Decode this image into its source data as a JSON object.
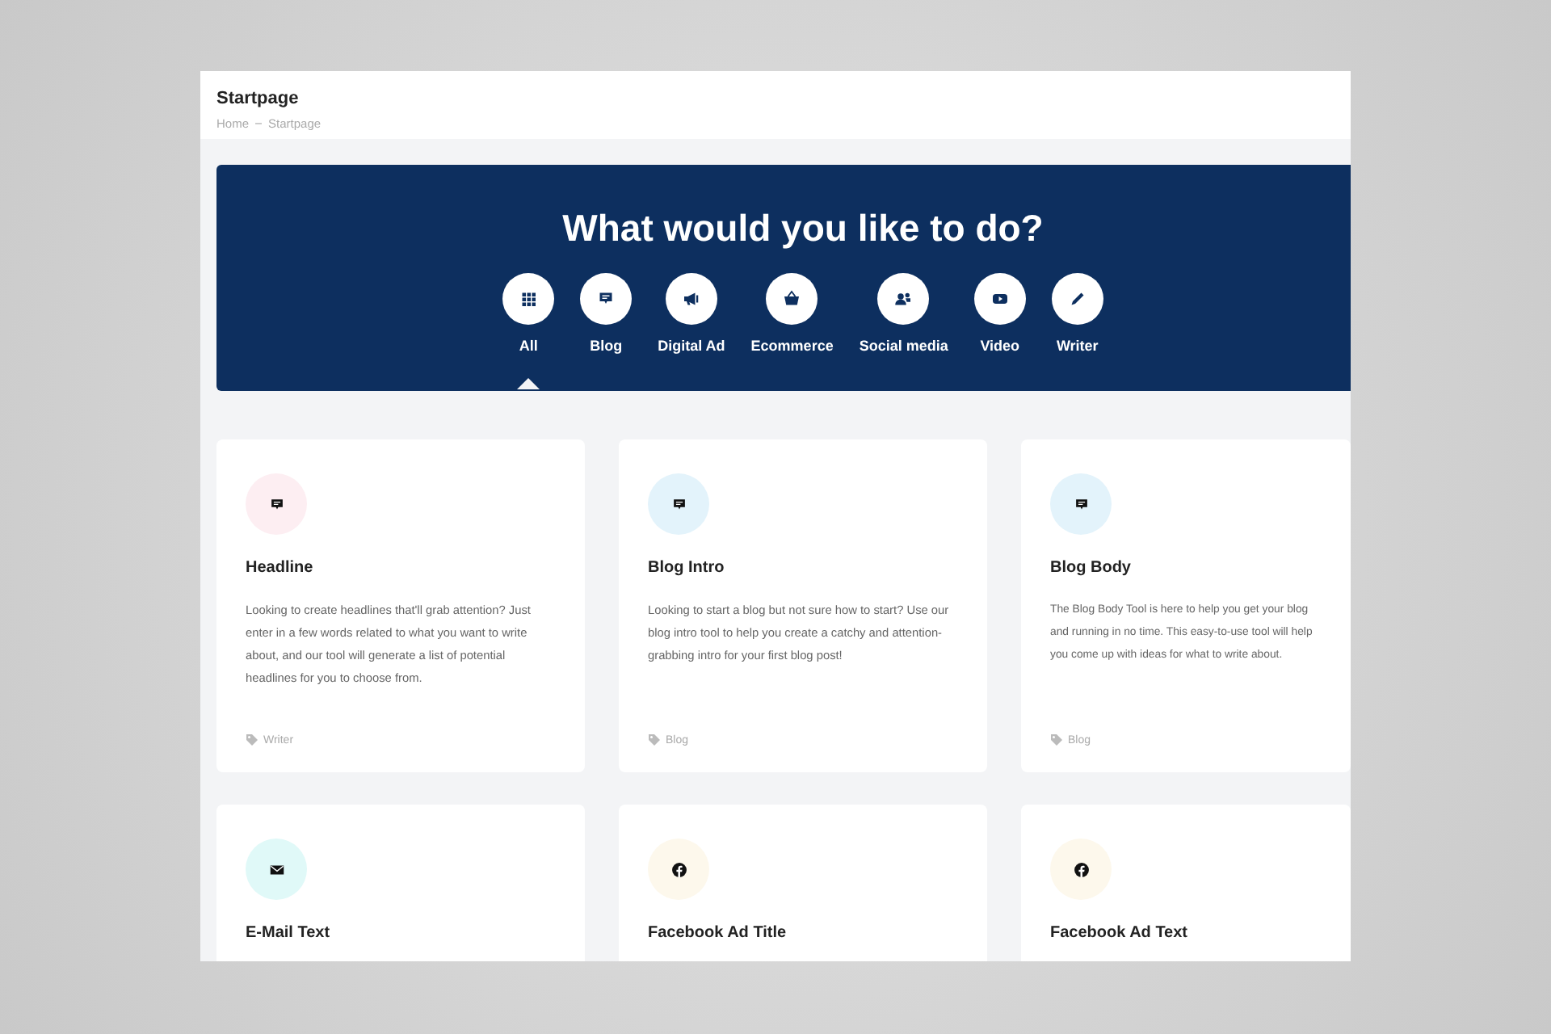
{
  "header": {
    "title": "Startpage",
    "breadcrumb": [
      "Home",
      "Startpage"
    ]
  },
  "banner": {
    "title": "What would you like to do?",
    "categories": [
      {
        "label": "All",
        "kind": "grid",
        "selected": true
      },
      {
        "label": "Blog",
        "kind": "chat",
        "selected": false
      },
      {
        "label": "Digital Ad",
        "kind": "megaphone",
        "selected": false
      },
      {
        "label": "Ecommerce",
        "kind": "basket",
        "selected": false
      },
      {
        "label": "Social media",
        "kind": "people",
        "selected": false
      },
      {
        "label": "Video",
        "kind": "video",
        "selected": false
      },
      {
        "label": "Writer",
        "kind": "pencil",
        "selected": false
      }
    ]
  },
  "cards": [
    {
      "title": "Headline",
      "kind": "chat",
      "color": "#fdeef2",
      "description": "Looking to create headlines that'll grab attention? Just enter in a few words related to what you want to write about, and our tool will generate a list of potential headlines for you to choose from.",
      "tag": "Writer"
    },
    {
      "title": "Blog Intro",
      "kind": "chat",
      "color": "#e3f3fb",
      "description": "Looking to start a blog but not sure how to start? Use our blog intro tool to help you create a catchy and attention-grabbing intro for your first blog post!",
      "tag": "Blog"
    },
    {
      "title": "Blog Body",
      "kind": "chat",
      "color": "#e3f3fb",
      "description": "The Blog Body Tool is here to help you get your blog\nand running in no time. This easy-to-use tool will help\nyou come up with ideas for what to write about.",
      "tag": "Blog"
    },
    {
      "title": "E-Mail Text",
      "kind": "mail",
      "color": "#e0f9f8"
    },
    {
      "title": "Facebook Ad Title",
      "kind": "facebook",
      "color": "#fdf8ec"
    },
    {
      "title": "Facebook Ad Text",
      "kind": "facebook",
      "color": "#fdf8ec"
    }
  ]
}
